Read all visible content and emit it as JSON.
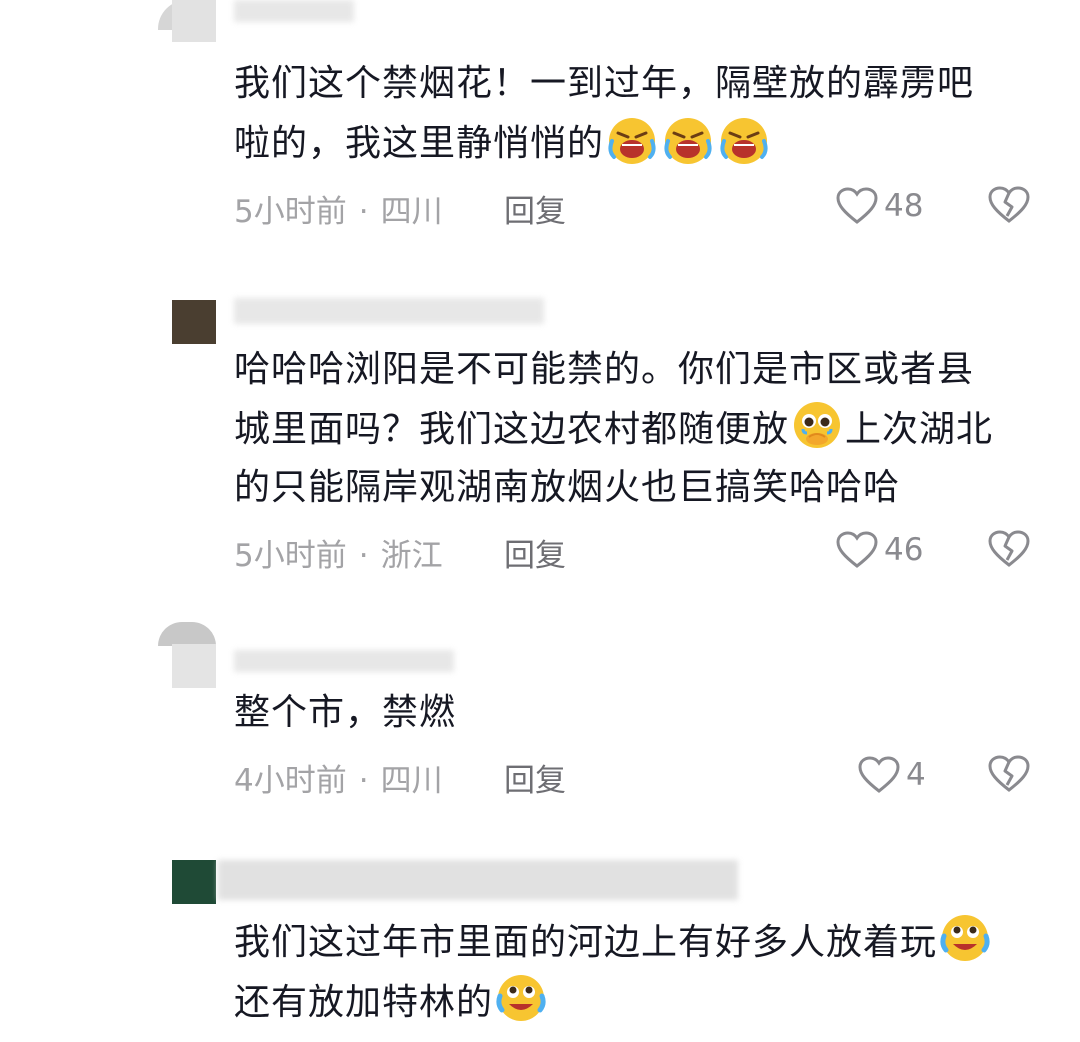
{
  "comments": [
    {
      "text_lines": [
        "我们这个禁烟花！一到过年，隔壁放的霹雳吧",
        "啦的，我这里静悄悄的"
      ],
      "emoji": [
        "crying-face",
        "crying-face",
        "crying-face"
      ],
      "time": "5小时前",
      "location": "四川",
      "reply": "回复",
      "likes": "48"
    },
    {
      "text_lines": [
        "哈哈哈浏阳是不可能禁的。你们是市区或者县",
        "城里面吗？我们这边农村都随便放",
        "上次湖北",
        "的只能隔岸观湖南放烟火也巨搞笑哈哈哈"
      ],
      "emoji": [
        "holding-back-tears"
      ],
      "time": "5小时前",
      "location": "浙江",
      "reply": "回复",
      "likes": "46"
    },
    {
      "text_lines": [
        "整个市，禁燃"
      ],
      "emoji": [],
      "time": "4小时前",
      "location": "四川",
      "reply": "回复",
      "likes": "4"
    },
    {
      "text_lines": [
        "我们这过年市里面的河边上有好多人放着玩",
        "还有放加特林的"
      ],
      "emoji": [
        "tears-of-joy",
        "tears-of-joy"
      ]
    }
  ],
  "meta_sep": "·",
  "colors": {
    "text": "#161823",
    "meta": "#a3a3a6",
    "emoji_yellow": "#f7c531"
  }
}
